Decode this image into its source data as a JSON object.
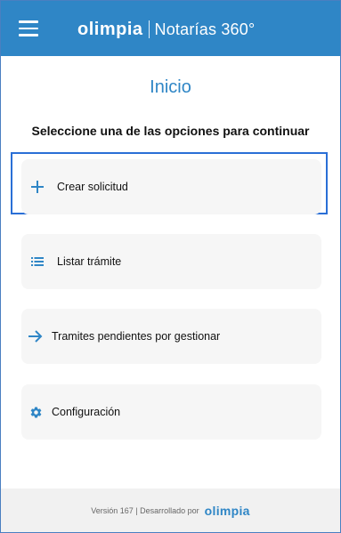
{
  "header": {
    "brand_logo": "olimpia",
    "product_name": "Notarías 360°"
  },
  "page": {
    "title": "Inicio",
    "subtitle": "Seleccione una de las opciones para continuar"
  },
  "options": [
    {
      "label": "Crear solicitud",
      "icon": "plus-icon",
      "selected": true
    },
    {
      "label": "Listar trámite",
      "icon": "list-icon",
      "selected": false
    },
    {
      "label": "Tramites pendientes por gestionar",
      "icon": "arrow-right-icon",
      "selected": false
    },
    {
      "label": "Configuración",
      "icon": "gear-icon",
      "selected": false
    }
  ],
  "footer": {
    "text": "Versión 167 | Desarrollado por",
    "logo": "olimpia"
  },
  "colors": {
    "brand": "#2f86c6",
    "focus": "#2a6fd6"
  }
}
